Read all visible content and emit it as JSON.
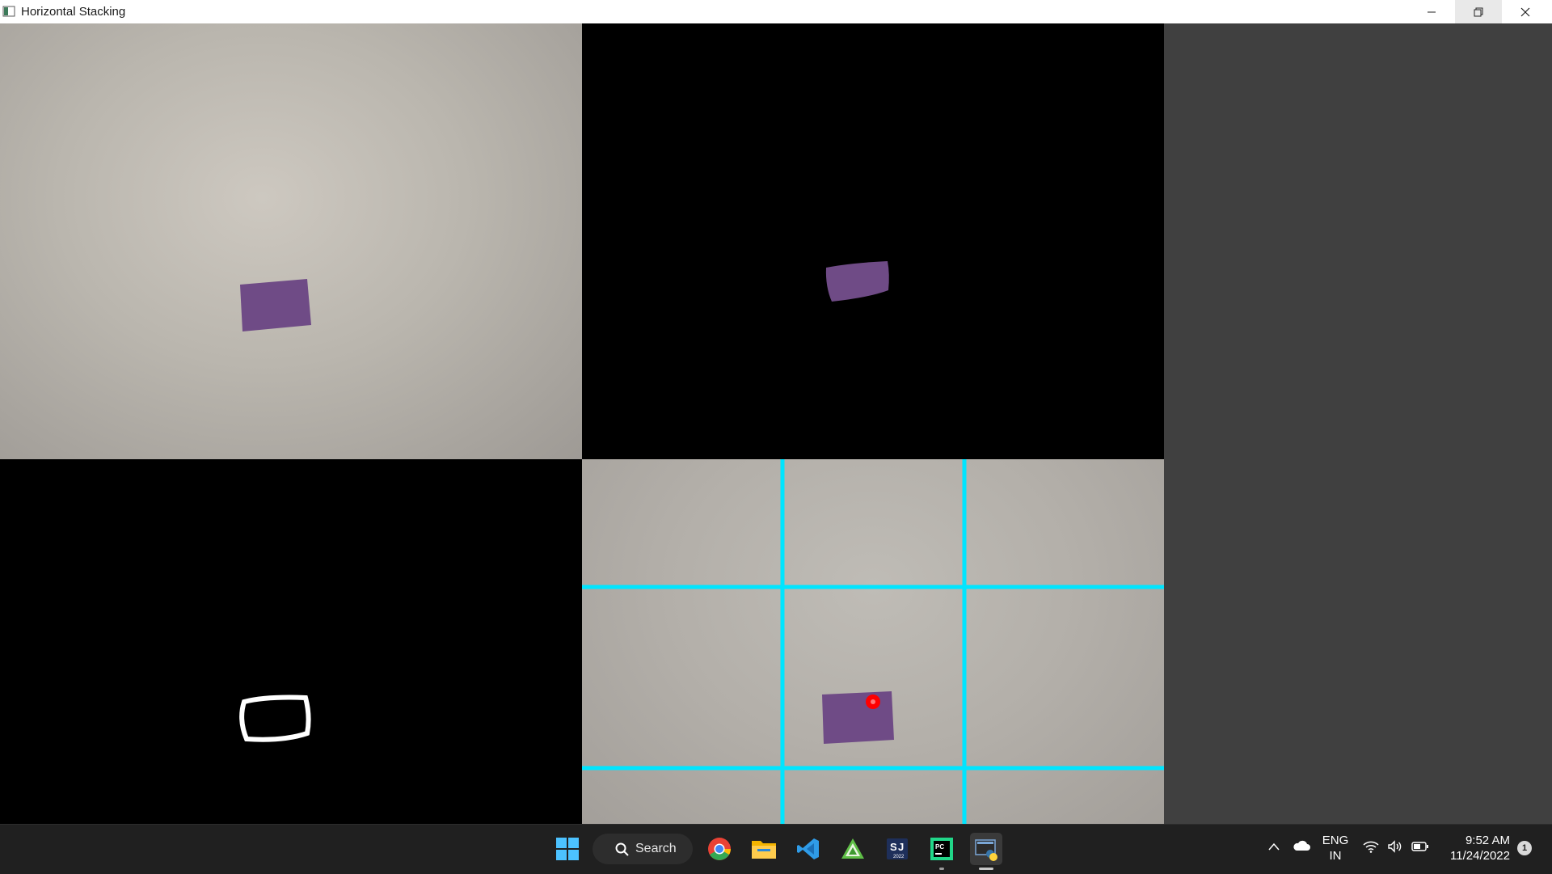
{
  "window": {
    "title": "Horizontal Stacking",
    "minimize_icon": "minimize-icon",
    "restore_icon": "restore-icon",
    "close_icon": "close-icon"
  },
  "panels": [
    {
      "name": "original-frame",
      "kind": "camera"
    },
    {
      "name": "masked-frame",
      "kind": "mask"
    },
    {
      "name": "contour-frame",
      "kind": "contour"
    },
    {
      "name": "grid-frame",
      "kind": "camera-grid"
    }
  ],
  "colors": {
    "grid_line": "#00e5ff",
    "centroid_dot": "#ff0000",
    "object": "#6f4b86",
    "contour": "#ffffff"
  },
  "taskbar": {
    "search_label": "Search",
    "apps": [
      "start-icon",
      "chrome-icon",
      "file-explorer-icon",
      "vscode-icon",
      "app-green-icon",
      "app-2022-icon",
      "pycharm-icon",
      "python-app-icon"
    ],
    "app_2022_label": "2022",
    "tray": {
      "language_line1": "ENG",
      "language_line2": "IN",
      "time": "9:52 AM",
      "date": "11/24/2022",
      "notification_count": "1"
    }
  }
}
